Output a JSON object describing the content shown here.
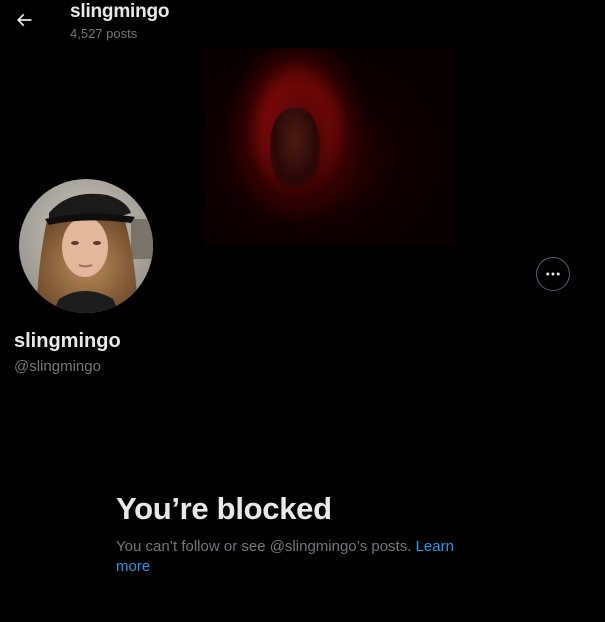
{
  "header": {
    "name": "slingmingo",
    "post_count": "4,527 posts",
    "back_icon": "arrow-left-icon"
  },
  "profile": {
    "display_name": "slingmingo",
    "handle": "@slingmingo",
    "more_icon": "more-horizontal-icon"
  },
  "blocked": {
    "title": "You’re blocked",
    "message": "You can’t follow or see @slingmingo’s posts.",
    "learn_more": "Learn more"
  },
  "colors": {
    "background": "#000000",
    "primary_text": "#e7e9ea",
    "secondary_text": "#71767b",
    "link": "#1d9bf0",
    "border": "#536471"
  }
}
